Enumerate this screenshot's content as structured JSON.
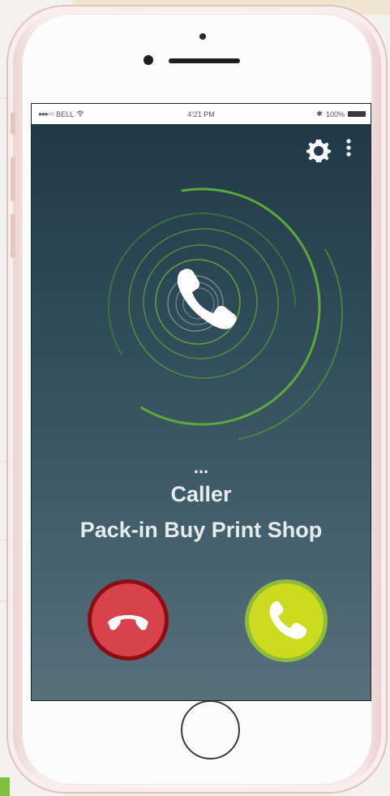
{
  "status_bar": {
    "carrier": "BELL",
    "time": "4:21 PM",
    "battery": "100%"
  },
  "toolbar": {
    "settings_icon": "gear-icon",
    "menu_icon": "more-vertical-icon"
  },
  "call": {
    "status": "...",
    "label": "Caller",
    "caller_name": "Pack-in Buy Print Shop"
  },
  "actions": {
    "decline_icon": "phone-hangup-icon",
    "accept_icon": "phone-answer-icon"
  },
  "colors": {
    "ring_green": "#6fbf3f",
    "decline": "#d8424b",
    "accept": "#cddb1e"
  }
}
